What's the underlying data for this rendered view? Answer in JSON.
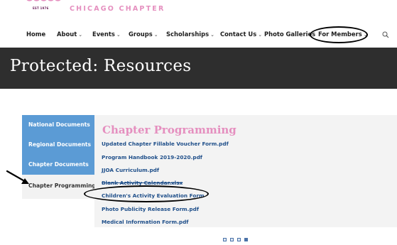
{
  "logo": {
    "est": "EST 1976",
    "name": "CHICAGO CHAPTER"
  },
  "nav": {
    "items": [
      {
        "label": "Home",
        "chevron": ""
      },
      {
        "label": "About",
        "chevron": "⌄"
      },
      {
        "label": "Events",
        "chevron": "⌄"
      },
      {
        "label": "Groups",
        "chevron": "⌄"
      },
      {
        "label": "Scholarships",
        "chevron": "⌄"
      },
      {
        "label": "Contact Us",
        "chevron": "⌄"
      },
      {
        "label": "Photo Galleries",
        "chevron": ""
      },
      {
        "label": "For Members",
        "chevron": "⌄"
      }
    ],
    "search_icon": "search-icon"
  },
  "page_title": "Protected: Resources",
  "tabs": [
    {
      "label": "National Documents",
      "active": false
    },
    {
      "label": "Regional Documents",
      "active": false
    },
    {
      "label": "Chapter Documents",
      "active": false
    },
    {
      "label": "Chapter Programming",
      "active": true
    }
  ],
  "panel": {
    "heading": "Chapter Programming",
    "links": [
      "Updated Chapter Fillable Voucher Form.pdf",
      "Program Handbook 2019-2020.pdf",
      "JJOA Curriculum.pdf",
      "Blank Activity Calendar.xlsx",
      "Children's Activity Evaluation Form",
      "Photo Publicity Release Form.pdf",
      "Medical Information Form.pdf"
    ]
  },
  "pager": {
    "count": 4,
    "active_index": 3
  },
  "colors": {
    "tab_blue": "#5b9bd5",
    "title_bar": "#2e2e2e",
    "accent_pink": "#e58fbf",
    "link_blue": "#1f4f8a",
    "panel_bg": "#f3f3f3"
  }
}
